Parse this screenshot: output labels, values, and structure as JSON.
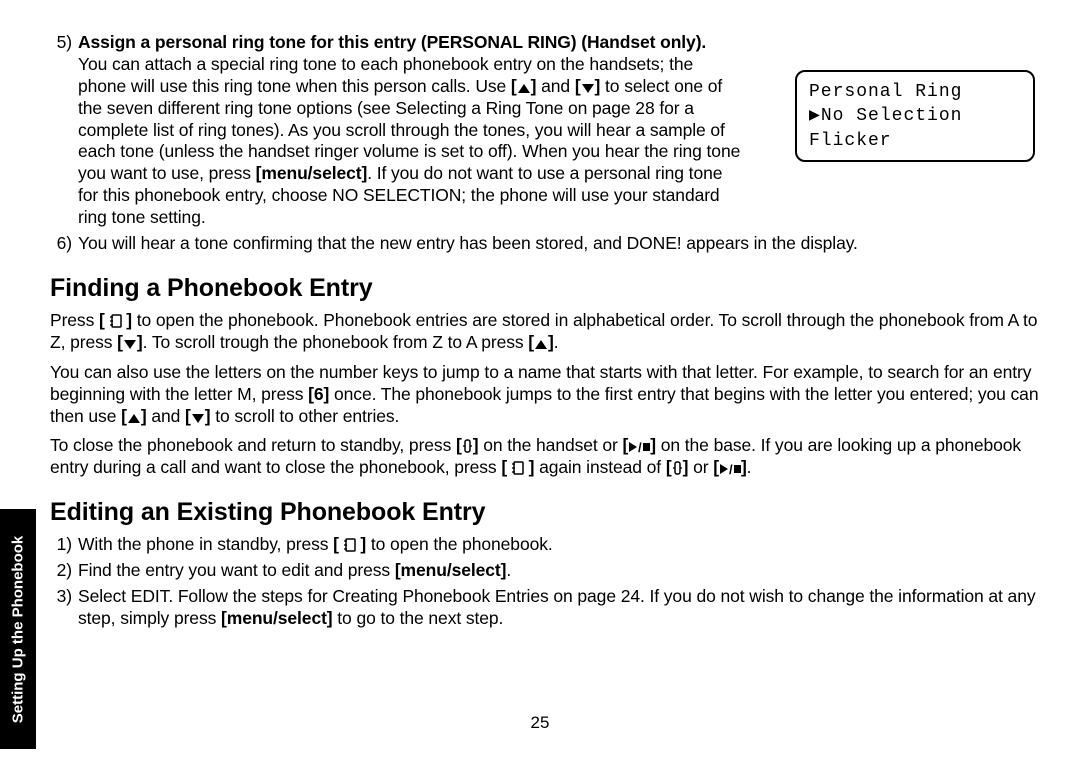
{
  "sideTab": "Setting Up the Phonebook",
  "item5": {
    "num": "5)",
    "title": "Assign a personal ring tone for this entry (PERSONAL RING) (Handset only).",
    "body_a": "You can attach a special ring tone to each phonebook entry on the handsets; the phone will use this ring tone when this person calls. Use ",
    "body_b": " and ",
    "body_c": " to select one of the seven different ring tone options (see Selecting a Ring Tone on page 28 for a complete list of ring tones). As you scroll through the tones, you will hear a sample of each tone (unless the handset ringer volume is set to off). When you hear the ring tone you want to use, press ",
    "menu": "[menu/select]",
    "body_d": ". If you do not want to use a personal ring tone for this phonebook entry, choose NO SELECTION; the phone will use your standard ring tone setting."
  },
  "item6": {
    "num": "6)",
    "body": "You will hear a tone confirming that the new entry has been stored, and DONE! appears in the display."
  },
  "lcd": {
    "line1": "Personal Ring",
    "line2": "No Selection",
    "line3": "Flicker"
  },
  "sec1": {
    "title": "Finding a Phonebook Entry",
    "p1a": "Press ",
    "p1b": " to open the phonebook. Phonebook entries are stored in alphabetical order. To scroll through the phonebook from A to Z, press ",
    "p1c": ". To scroll trough the phonebook from Z to A press ",
    "p1d": ".",
    "p2a": "You can also use the letters on the number keys to jump to a name that starts with that letter. For example, to search for an entry beginning with the letter M, press ",
    "key6": "[6]",
    "p2b": " once. The phonebook jumps to the first entry that begins with the letter you entered; you can then use ",
    "p2c": " and ",
    "p2d": " to scroll to other entries.",
    "p3a": "To close the phonebook and return to standby, press ",
    "p3b": " on the handset or ",
    "p3c": " on the base. If you are looking up a phonebook entry during a call and want to close the phonebook, press ",
    "p3d": " again instead of ",
    "p3e": " or ",
    "p3f": "."
  },
  "sec2": {
    "title": "Editing an Existing Phonebook Entry",
    "s1n": "1)",
    "s1a": "With the phone in standby, press ",
    "s1b": " to open the phonebook.",
    "s2n": "2)",
    "s2a": "Find the entry you want to edit and press ",
    "s2b": "[menu/select]",
    "s2c": ".",
    "s3n": "3)",
    "s3a": "Select EDIT. Follow the steps for Creating Phonebook Entries on page 24. If you do not wish to change the information at any step, simply press ",
    "s3b": "[menu/select]",
    "s3c": " to go to the next step."
  },
  "pageNum": "25"
}
